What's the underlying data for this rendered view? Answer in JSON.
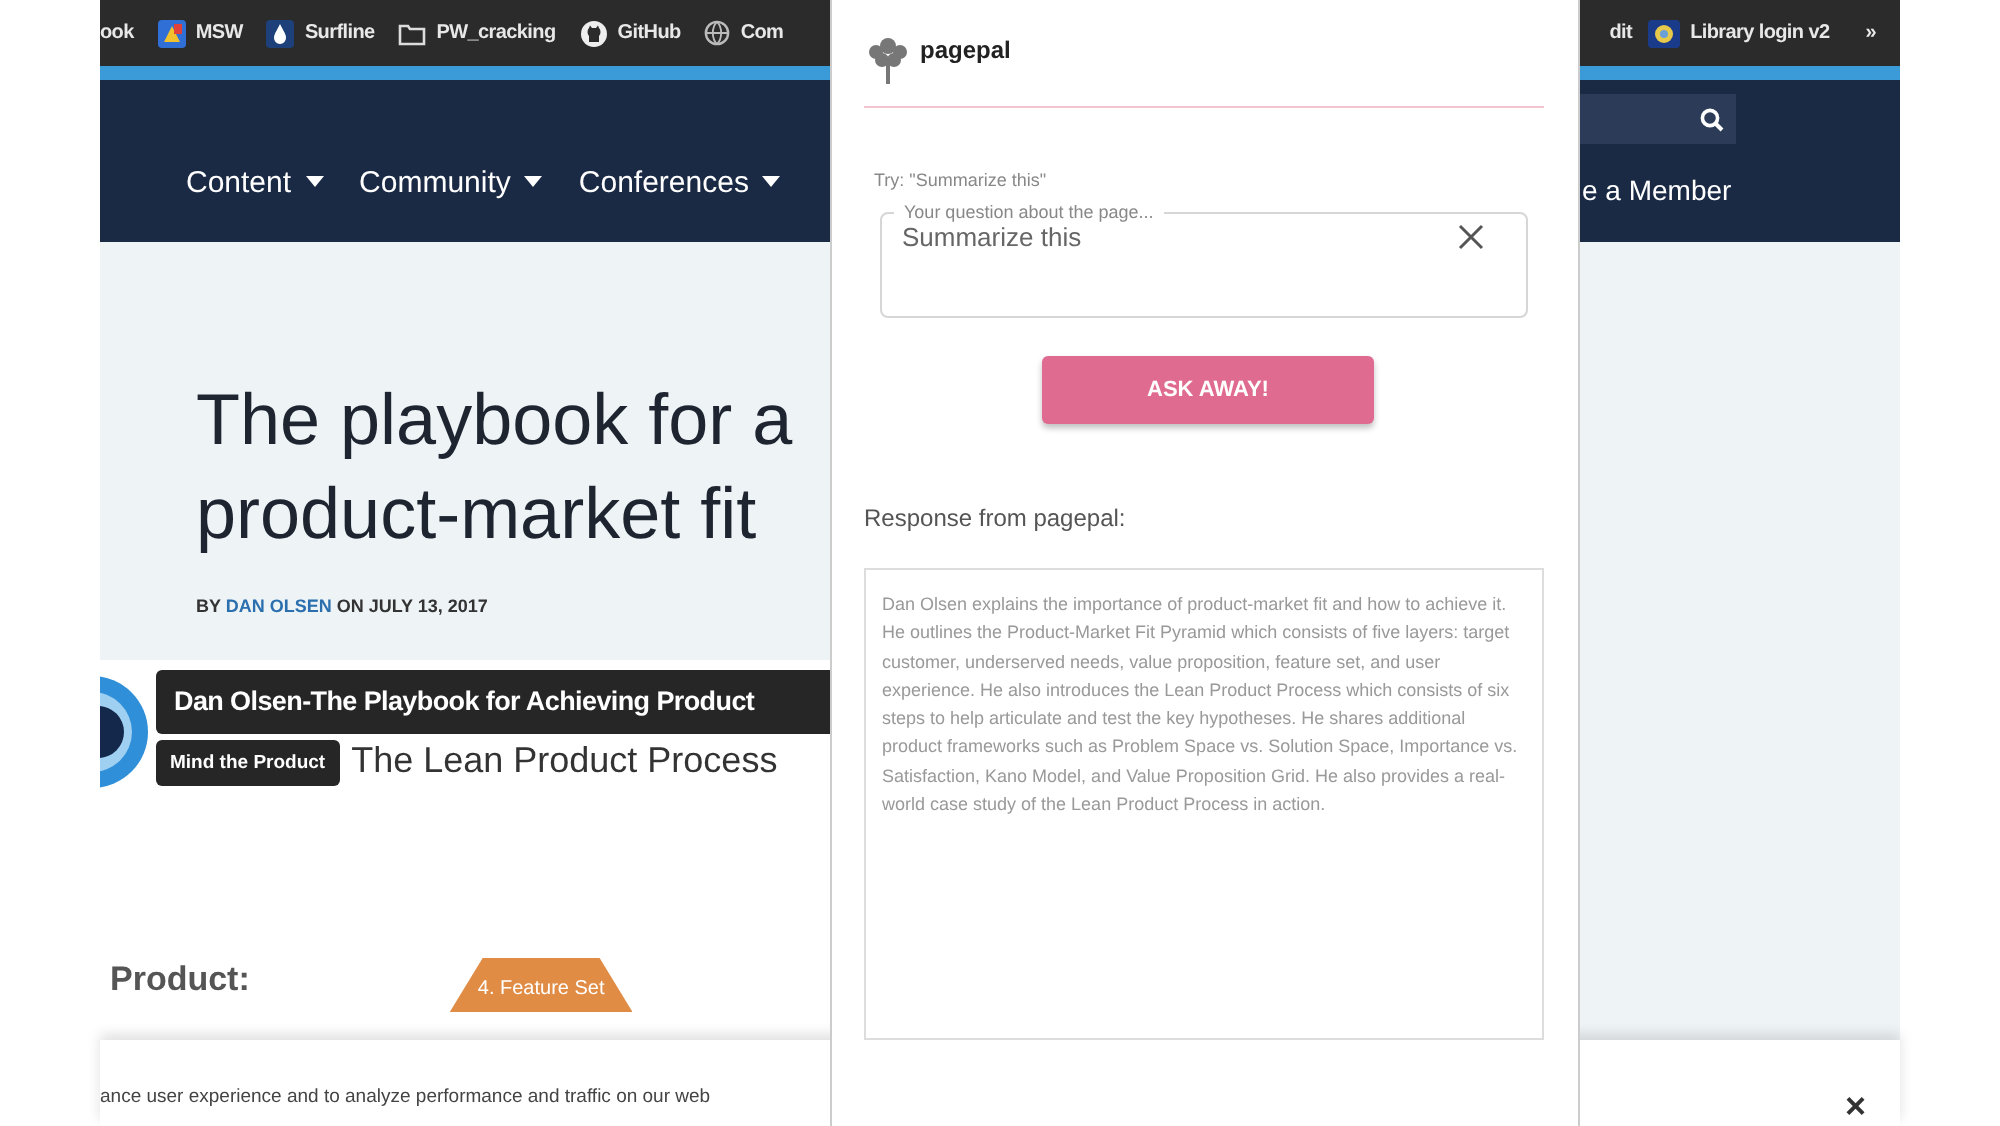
{
  "bookmarks_bar": {
    "left_items": [
      {
        "label": "ook",
        "kind": "text"
      },
      {
        "label": "MSW",
        "kind": "tile"
      },
      {
        "label": "Surfline",
        "kind": "drop"
      },
      {
        "label": "PW_cracking",
        "kind": "folder"
      },
      {
        "label": "GitHub",
        "kind": "github"
      },
      {
        "label": "Com",
        "kind": "globe"
      }
    ],
    "right_items": [
      {
        "label": "dit",
        "kind": "text"
      },
      {
        "label": "Library login v2",
        "kind": "badge"
      }
    ],
    "overflow": "»"
  },
  "nav": {
    "items": [
      {
        "label": "Content"
      },
      {
        "label": "Community"
      },
      {
        "label": "Conferences"
      }
    ],
    "right_link": "e a Member"
  },
  "article": {
    "title_lines": [
      "The playbook for a",
      "product-market fit"
    ],
    "byline_prefix": "BY",
    "author": "DAN OLSEN",
    "byline_date": "ON JULY 13, 2017"
  },
  "video": {
    "title": "Dan Olsen-The Playbook for Achieving Product",
    "channel": "Mind the Product",
    "slide_title": "The Lean Product Process",
    "section_heading": "Product:",
    "pyramid_label": "4. Feature Set"
  },
  "cookie_banner": {
    "text": "ance user experience and to analyze performance and traffic on our web",
    "close": "×"
  },
  "popup": {
    "brand": "pagepal",
    "hint": "Try: \"Summarize this\"",
    "question_label": "Your question about the page...",
    "question_value": "Summarize this",
    "button": "ASK AWAY!",
    "response_heading": "Response from pagepal:",
    "response": "Dan Olsen explains the importance of product-market fit and how to achieve it. He outlines the Product-Market Fit Pyramid which consists of five layers: target customer, underserved needs, value proposition, feature set, and user experience. He also introduces the Lean Product Process which consists of six steps to help articulate and test the key hypotheses. He shares additional product frameworks such as Problem Space vs. Solution Space, Importance vs. Satisfaction, Kano Model, and Value Proposition Grid. He also provides a real-world case study of the Lean Product Process in action."
  }
}
